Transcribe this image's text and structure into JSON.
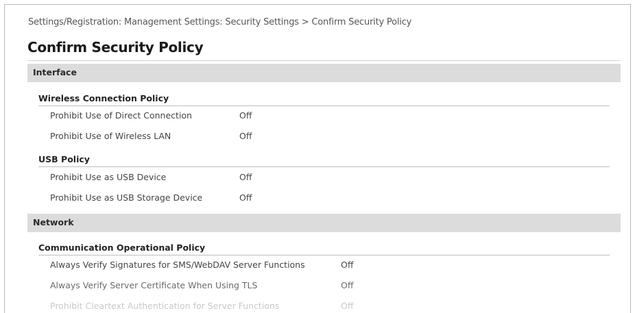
{
  "breadcrumb": "Settings/Registration: Management Settings: Security Settings > Confirm Security Policy",
  "page_title": "Confirm Security Policy",
  "sections": [
    {
      "label": "Interface",
      "groups": [
        {
          "title": "Wireless Connection Policy",
          "rows": [
            {
              "label": "Prohibit Use of Direct Connection",
              "value": "Off"
            },
            {
              "label": "Prohibit Use of Wireless LAN",
              "value": "Off"
            }
          ]
        },
        {
          "title": "USB Policy",
          "rows": [
            {
              "label": "Prohibit Use as USB Device",
              "value": "Off"
            },
            {
              "label": "Prohibit Use as USB Storage Device",
              "value": "Off"
            }
          ]
        }
      ]
    },
    {
      "label": "Network",
      "groups": [
        {
          "title": "Communication Operational Policy",
          "rows": [
            {
              "label": "Always Verify Signatures for SMS/WebDAV Server Functions",
              "value": "Off"
            },
            {
              "label": "Always Verify Server Certificate When Using TLS",
              "value": "Off"
            },
            {
              "label": "Prohibit Cleartext Authentication for Server Functions",
              "value": "Off"
            }
          ]
        }
      ]
    }
  ]
}
